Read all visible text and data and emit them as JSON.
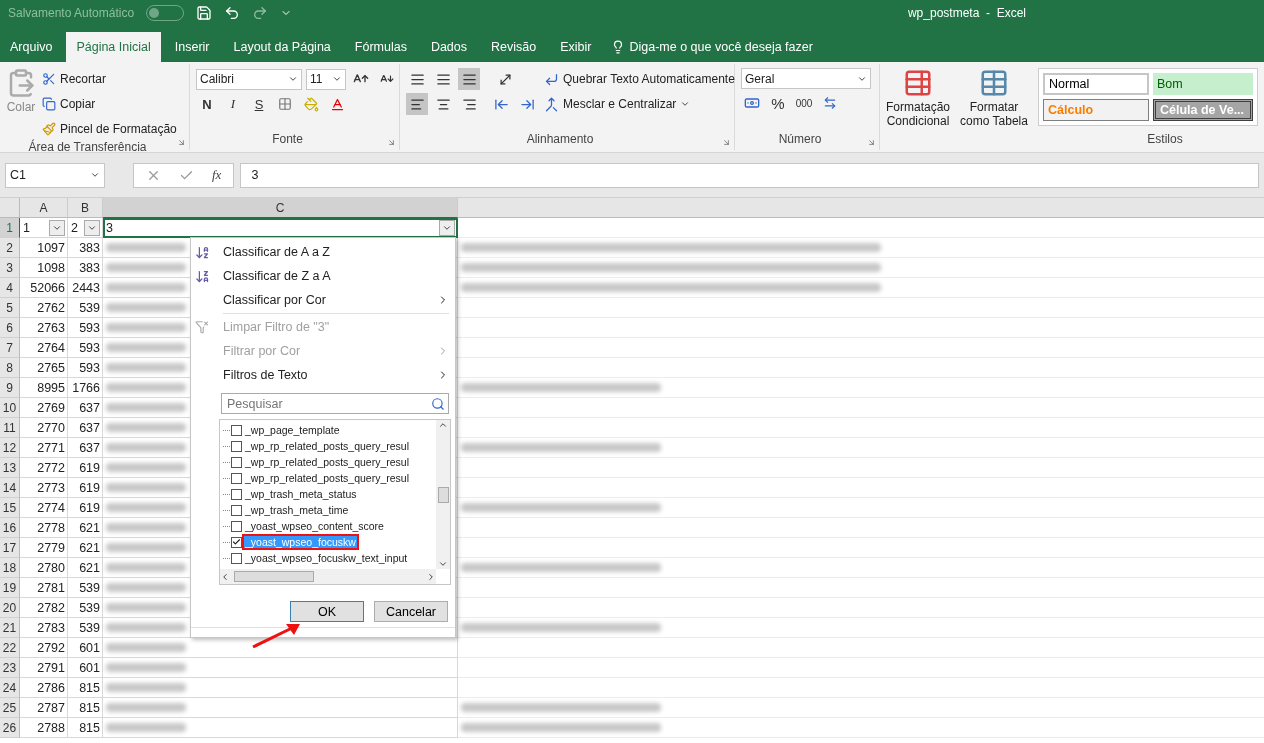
{
  "title_bar": {
    "autosave_label": "Salvamento Automático",
    "autosave_on": false,
    "title": "wp_postmeta  -  Excel"
  },
  "tabs": [
    {
      "label": "Arquivo",
      "selected": false
    },
    {
      "label": "Página Inicial",
      "selected": true
    },
    {
      "label": "Inserir",
      "selected": false
    },
    {
      "label": "Layout da Página",
      "selected": false
    },
    {
      "label": "Fórmulas",
      "selected": false
    },
    {
      "label": "Dados",
      "selected": false
    },
    {
      "label": "Revisão",
      "selected": false
    },
    {
      "label": "Exibir",
      "selected": false
    }
  ],
  "tell_me": "Diga-me o que você deseja fazer",
  "ribbon": {
    "clipboard": {
      "paste": "Colar",
      "cut": "Recortar",
      "copy": "Copiar",
      "format_painter": "Pincel de Formatação",
      "group": "Área de Transferência"
    },
    "font": {
      "name": "Calibri",
      "size": "11",
      "bold": "N",
      "italic": "I",
      "underline": "S",
      "group": "Fonte"
    },
    "alignment": {
      "wrap": "Quebrar Texto Automaticamente",
      "merge": "Mesclar e Centralizar",
      "group": "Alinhamento"
    },
    "number": {
      "format": "Geral",
      "percent": "%",
      "thousands": "000",
      "group": "Número"
    },
    "conditional": "Formatação Condicional",
    "format_table": "Formatar como Tabela",
    "styles": [
      {
        "label": "Normal",
        "kind": "normal"
      },
      {
        "label": "Bom",
        "kind": "good"
      },
      {
        "label": "Cálculo",
        "kind": "calc"
      },
      {
        "label": "Célula de Ve...",
        "kind": "check"
      }
    ],
    "styles_group": "Estilos"
  },
  "formula_bar": {
    "name_box": "C1",
    "fx": "fx",
    "value": "3"
  },
  "sheet": {
    "columns": [
      "A",
      "B",
      "C"
    ],
    "header_row_number": "1",
    "header": [
      "1",
      "2",
      "3"
    ],
    "rows": [
      {
        "n": "2",
        "a": "1097",
        "b": "383",
        "long": true
      },
      {
        "n": "3",
        "a": "1098",
        "b": "383",
        "long": true
      },
      {
        "n": "4",
        "a": "52066",
        "b": "2443",
        "long": true
      },
      {
        "n": "5",
        "a": "2762",
        "b": "539",
        "long": false
      },
      {
        "n": "6",
        "a": "2763",
        "b": "593",
        "long": false
      },
      {
        "n": "7",
        "a": "2764",
        "b": "593",
        "long": false
      },
      {
        "n": "8",
        "a": "2765",
        "b": "593",
        "long": false
      },
      {
        "n": "9",
        "a": "8995",
        "b": "1766",
        "long": true
      },
      {
        "n": "10",
        "a": "2769",
        "b": "637",
        "long": false
      },
      {
        "n": "11",
        "a": "2770",
        "b": "637",
        "long": false
      },
      {
        "n": "12",
        "a": "2771",
        "b": "637",
        "long": true
      },
      {
        "n": "13",
        "a": "2772",
        "b": "619",
        "long": false
      },
      {
        "n": "14",
        "a": "2773",
        "b": "619",
        "long": false
      },
      {
        "n": "15",
        "a": "2774",
        "b": "619",
        "long": true
      },
      {
        "n": "16",
        "a": "2778",
        "b": "621",
        "long": false
      },
      {
        "n": "17",
        "a": "2779",
        "b": "621",
        "long": false
      },
      {
        "n": "18",
        "a": "2780",
        "b": "621",
        "long": true
      },
      {
        "n": "19",
        "a": "2781",
        "b": "539",
        "long": false
      },
      {
        "n": "20",
        "a": "2782",
        "b": "539",
        "long": false
      },
      {
        "n": "21",
        "a": "2783",
        "b": "539",
        "long": true
      },
      {
        "n": "22",
        "a": "2792",
        "b": "601",
        "long": false
      },
      {
        "n": "23",
        "a": "2791",
        "b": "601",
        "long": false
      },
      {
        "n": "24",
        "a": "2786",
        "b": "815",
        "long": false
      },
      {
        "n": "25",
        "a": "2787",
        "b": "815",
        "long": true
      },
      {
        "n": "26",
        "a": "2788",
        "b": "815",
        "long": true
      }
    ]
  },
  "filter_menu": {
    "items": [
      {
        "label": "Classificar de A a Z",
        "kind": "sort-az",
        "disabled": false,
        "submenu": false
      },
      {
        "label": "Classificar de Z a A",
        "kind": "sort-za",
        "disabled": false,
        "submenu": false
      },
      {
        "label": "Classificar por Cor",
        "kind": "plain",
        "disabled": false,
        "submenu": true
      },
      {
        "label": "Limpar Filtro de \"3\"",
        "kind": "clear",
        "disabled": true,
        "submenu": false
      },
      {
        "label": "Filtrar por Cor",
        "kind": "plain",
        "disabled": true,
        "submenu": true
      },
      {
        "label": "Filtros de Texto",
        "kind": "plain",
        "disabled": false,
        "submenu": true
      }
    ],
    "search_placeholder": "Pesquisar",
    "values": [
      {
        "label": "_wp_page_template",
        "checked": false,
        "selected": false
      },
      {
        "label": "_wp_rp_related_posts_query_resul",
        "checked": false,
        "selected": false
      },
      {
        "label": "_wp_rp_related_posts_query_resul",
        "checked": false,
        "selected": false
      },
      {
        "label": "_wp_rp_related_posts_query_resul",
        "checked": false,
        "selected": false
      },
      {
        "label": "_wp_trash_meta_status",
        "checked": false,
        "selected": false
      },
      {
        "label": "_wp_trash_meta_time",
        "checked": false,
        "selected": false
      },
      {
        "label": "_yoast_wpseo_content_score",
        "checked": false,
        "selected": false
      },
      {
        "label": "_yoast_wpseo_focuskw",
        "checked": true,
        "selected": true
      },
      {
        "label": "_yoast_wpseo_focuskw_text_input",
        "checked": false,
        "selected": false
      }
    ],
    "ok": "OK",
    "cancel": "Cancelar"
  }
}
